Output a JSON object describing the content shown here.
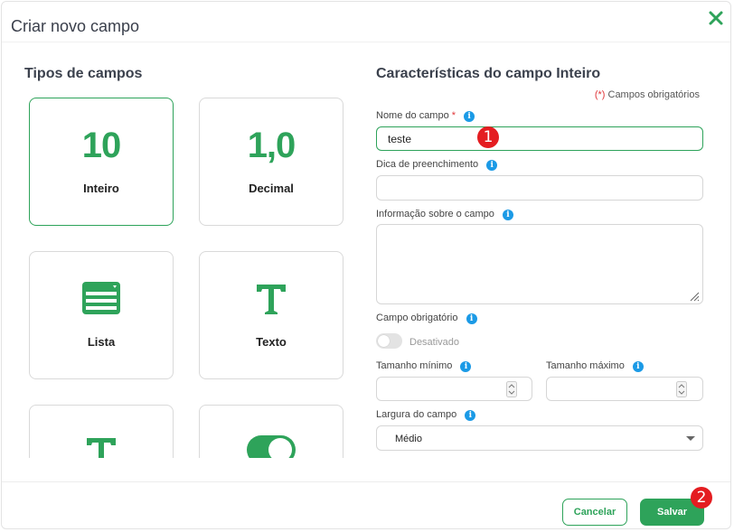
{
  "dialog": {
    "title": "Criar novo campo"
  },
  "types": {
    "title": "Tipos de campos",
    "items": [
      {
        "label": "Inteiro",
        "glyph": "10",
        "icon": "integer-glyph"
      },
      {
        "label": "Decimal",
        "glyph": "1,0",
        "icon": "decimal-glyph"
      },
      {
        "label": "Lista",
        "icon": "list-icon"
      },
      {
        "label": "Texto",
        "icon": "text-icon"
      },
      {
        "label": "",
        "icon": "text-icon"
      },
      {
        "label": "",
        "icon": "toggle-icon"
      }
    ]
  },
  "form": {
    "title": "Características do campo Inteiro",
    "required_note_mark": "(*)",
    "required_note_text": "Campos obrigatórios",
    "name": {
      "label": "Nome do campo",
      "value": "teste"
    },
    "hint": {
      "label": "Dica de preenchimento",
      "value": ""
    },
    "info": {
      "label": "Informação sobre o campo",
      "value": ""
    },
    "required": {
      "label": "Campo obrigatório",
      "state_text": "Desativado"
    },
    "min_size": {
      "label": "Tamanho mínimo",
      "value": ""
    },
    "max_size": {
      "label": "Tamanho máximo",
      "value": ""
    },
    "width": {
      "label": "Largura do campo",
      "selected": "Médio"
    }
  },
  "footer": {
    "cancel_label": "Cancelar",
    "save_label": "Salvar"
  },
  "markers": [
    "1",
    "2"
  ],
  "colors": {
    "accent": "#2ea35a",
    "info": "#1b9ae6",
    "marker": "#e41d21"
  }
}
